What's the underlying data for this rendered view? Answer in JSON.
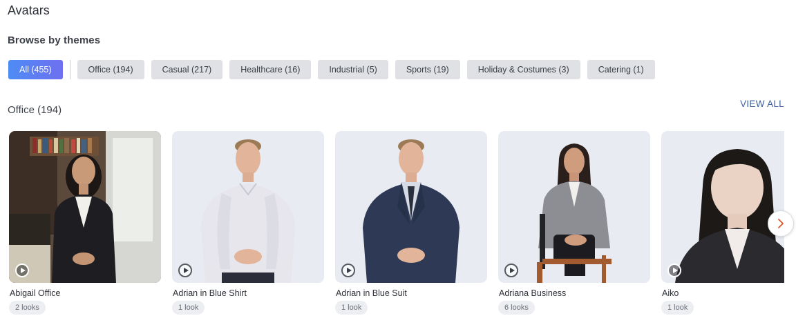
{
  "page": {
    "title": "Avatars"
  },
  "themes": {
    "label": "Browse by themes",
    "chips": [
      {
        "label": "All (455)",
        "active": true
      },
      {
        "label": "Office (194)"
      },
      {
        "label": "Casual (217)"
      },
      {
        "label": "Healthcare (16)"
      },
      {
        "label": "Industrial (5)"
      },
      {
        "label": "Sports (19)"
      },
      {
        "label": "Holiday & Costumes (3)"
      },
      {
        "label": "Catering (1)"
      }
    ]
  },
  "group": {
    "title": "Office (194)",
    "view_all": "VIEW ALL",
    "cards": [
      {
        "name": "Abigail Office",
        "looks": "2 looks"
      },
      {
        "name": "Adrian in Blue Shirt",
        "looks": "1 look"
      },
      {
        "name": "Adrian in Blue Suit",
        "looks": "1 look"
      },
      {
        "name": "Adriana Business",
        "looks": "6 looks"
      },
      {
        "name": "Aiko",
        "looks": "1 look"
      }
    ]
  },
  "icons": {
    "play": "play-icon",
    "next": "chevron-right-icon"
  },
  "colors": {
    "accent_start": "#4d8cf5",
    "accent_end": "#6f6ff0",
    "link": "#3e5d9c",
    "next_arrow": "#d9552b"
  }
}
